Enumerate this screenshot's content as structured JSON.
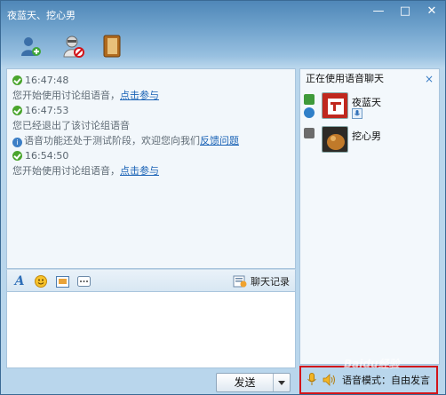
{
  "window": {
    "title": "夜蓝天、挖心男",
    "minimize_label": "—",
    "maximize_label": "□",
    "close_label": "✕"
  },
  "toolbar": {
    "items": [
      {
        "icon": "add-contact-icon"
      },
      {
        "icon": "voice-chat-icon"
      },
      {
        "icon": "notebook-icon"
      }
    ]
  },
  "chat": {
    "lines": [
      {
        "type": "time",
        "text": "16:47:48"
      },
      {
        "type": "msg",
        "text": "您开始使用讨论组语音，",
        "link": "点击参与"
      },
      {
        "type": "time",
        "text": "16:47:53"
      },
      {
        "type": "msg",
        "text": "您已经退出了该讨论组语音"
      },
      {
        "type": "info",
        "text": "语音功能还处于测试阶段，欢迎您向我们",
        "link": "反馈问题"
      },
      {
        "type": "time",
        "text": "16:54:50"
      },
      {
        "type": "msg",
        "text": "您开始使用讨论组语音，",
        "link": "点击参与"
      }
    ]
  },
  "formatbar": {
    "history_label": "聊天记录"
  },
  "send": {
    "label": "发送"
  },
  "side": {
    "header": "正在使用语音聊天",
    "close_label": "×",
    "members": [
      {
        "name": "夜蓝天",
        "avatar_color": "#c0281e"
      },
      {
        "name": "挖心男",
        "avatar_color": "#c07a2a"
      }
    ]
  },
  "voice": {
    "mode_label": "语音模式：自由发言"
  },
  "watermark": {
    "text": "Baidu经验"
  },
  "colors": {
    "highlight": "#d2141a",
    "link": "#1b63b6",
    "title_bar": "#4f87b8"
  }
}
